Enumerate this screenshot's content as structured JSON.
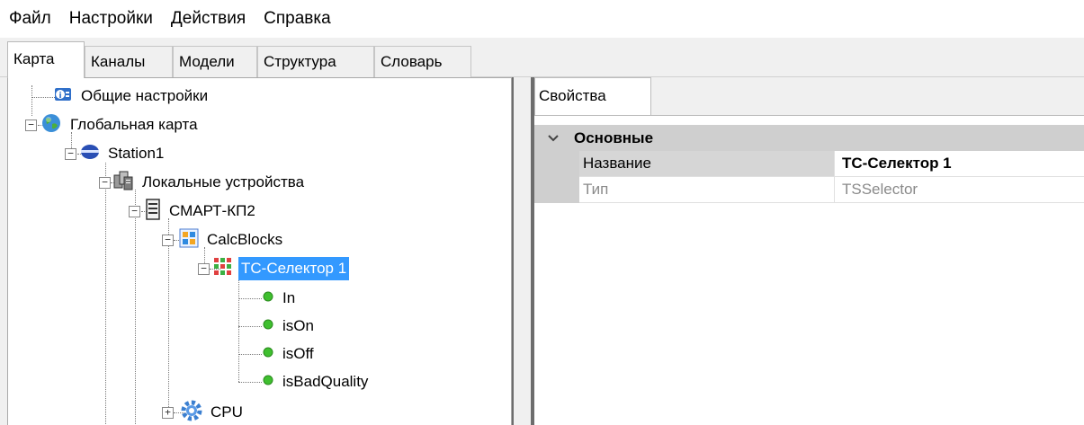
{
  "menu": {
    "items": [
      "Файл",
      "Настройки",
      "Действия",
      "Справка"
    ]
  },
  "tabs": {
    "items": [
      "Карта",
      "Каналы",
      "Модели",
      "Структура",
      "Словарь"
    ],
    "active_index": 0
  },
  "tree": {
    "general_settings": "Общие настройки",
    "global_map": "Глобальная карта",
    "station": "Station1",
    "local_devices": "Локальные устройства",
    "device": "СМАРТ-КП2",
    "calc_blocks": "CalcBlocks",
    "selector": "ТС-Селектор 1",
    "channels": [
      "In",
      "isOn",
      "isOff",
      "isBadQuality"
    ],
    "cpu": "CPU"
  },
  "properties": {
    "tab_label": "Свойства",
    "group_label": "Основные",
    "rows": [
      {
        "name": "Название",
        "value": "ТС-Селектор 1"
      },
      {
        "name": "Тип",
        "value": "TSSelector"
      }
    ]
  },
  "colors": {
    "selection": "#3399ff",
    "group_header": "#cfcfcf",
    "channel_dot": "#3fbf2f"
  }
}
